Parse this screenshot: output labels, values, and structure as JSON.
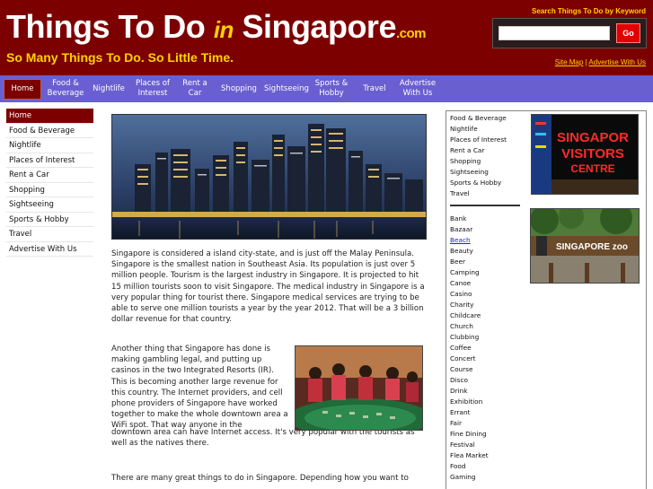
{
  "header": {
    "title_part1": "Things To Do",
    "title_in": "in",
    "title_part2": "Singapore",
    "title_dotcom": ".com",
    "tagline": "So Many Things To Do. So Little Time.",
    "search_label": "Search Things To Do by Keyword",
    "search_value": "",
    "search_button": "Go",
    "links": [
      "Site Map",
      "Advertise With Us"
    ],
    "link_separator": "|"
  },
  "nav": {
    "items": [
      {
        "label": "Home",
        "active": true
      },
      {
        "label": "Food & Beverage"
      },
      {
        "label": "Nightlife"
      },
      {
        "label": "Places of Interest"
      },
      {
        "label": "Rent a Car"
      },
      {
        "label": "Shopping"
      },
      {
        "label": "Sightseeing"
      },
      {
        "label": "Sports & Hobby"
      },
      {
        "label": "Travel"
      },
      {
        "label": "Advertise With Us"
      }
    ]
  },
  "leftnav": {
    "items": [
      {
        "label": "Home",
        "active": true
      },
      {
        "label": "Food & Beverage"
      },
      {
        "label": "Nightlife"
      },
      {
        "label": "Places of Interest"
      },
      {
        "label": "Rent a Car"
      },
      {
        "label": "Shopping"
      },
      {
        "label": "Sightseeing"
      },
      {
        "label": "Sports & Hobby"
      },
      {
        "label": "Travel"
      },
      {
        "label": "Advertise With Us"
      }
    ]
  },
  "content": {
    "para1": "Singapore is considered a island city-state, and is just off the Malay Peninsula. Singapore is the smallest nation in Southeast Asia. Its population is just over 5 million people. Tourism is the largest industry in Singapore. It is projected to hit 15 million tourists soon to visit Singapore. The medical industry in Singapore is a very popular thing for tourist there. Singapore medical services are trying to be able to serve one million tourists a year by the year 2012. That will be a 3 billion dollar revenue for that country.",
    "para2": "Another thing that Singapore has done is making gambling legal, and putting up casinos in the two Integrated Resorts (IR). This is becoming another large revenue for this country. The Internet providers, and cell phone providers of Singapore have worked together to make the whole downtown area a WiFi spot. That way anyone in the",
    "para2b": "downtown area can have Internet access. It's very popular with the tourists as well as the natives there.",
    "para3": "There are many great things to do in Singapore. Depending how you want to"
  },
  "rightcol": {
    "categories_top": [
      "Food & Beverage",
      "Nightlife",
      "Places of Interest",
      "Rent a Car",
      "Shopping",
      "Sightseeing",
      "Sports & Hobby",
      "Travel"
    ],
    "categories_bottom": [
      "Bank",
      "Bazaar",
      "Beach",
      "Beauty",
      "Beer",
      "Camping",
      "Canoe",
      "Casino",
      "Charity",
      "Childcare",
      "Church",
      "Clubbing",
      "Coffee",
      "Concert",
      "Course",
      "Disco",
      "Drink",
      "Exhibition",
      "Errant",
      "Fair",
      "Fine Dining",
      "Festival",
      "Flea Market",
      "Food",
      "Gaming"
    ],
    "highlighted": "Beach",
    "img1_text_line1": "SINGAPOR",
    "img1_text_line2": "VISITORS",
    "img1_text_line3": "CENTRE",
    "img2_text": "SINGAPORE zoo"
  },
  "colors": {
    "header_bg": "#7d0000",
    "accent_yellow": "#ffd200",
    "nav_bg": "#6a5fd0",
    "go_button": "#e00000"
  }
}
